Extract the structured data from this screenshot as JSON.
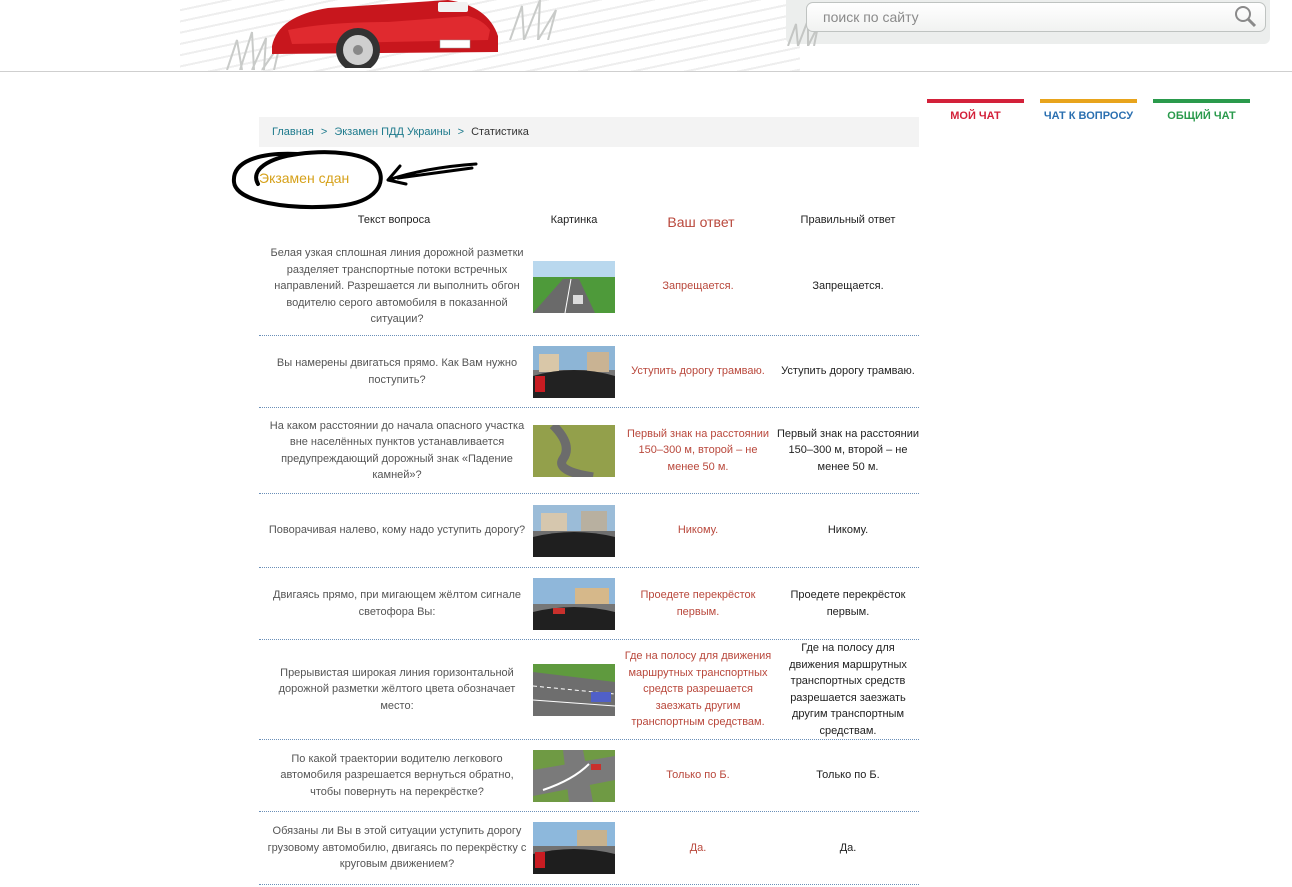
{
  "search": {
    "placeholder": "поиск по сайту"
  },
  "chat_tabs": {
    "my": "МОЙ ЧАТ",
    "question": "ЧАТ К ВОПРОСУ",
    "general": "ОБЩИЙ ЧАТ"
  },
  "breadcrumb": {
    "home": "Главная",
    "exam": "Экзамен ПДД Украины",
    "current": "Статистика",
    "separator": ">"
  },
  "exam_status": "Экзамен сдан",
  "table": {
    "headers": {
      "question": "Текст вопроса",
      "picture": "Картинка",
      "your_answer": "Ваш ответ",
      "correct_answer": "Правильный ответ"
    },
    "rows": [
      {
        "question": "Белая узкая сплошная линия дорожной разметки разделяет транспортные потоки встречных направлений. Разрешается ли выполнить обгон водителю серого автомобиля в показанной ситуации?",
        "answer": "Запрещается.",
        "correct": "Запрещается."
      },
      {
        "question": "Вы намерены двигаться прямо. Как Вам нужно поступить?",
        "answer": "Уступить дорогу трамваю.",
        "correct": "Уступить дорогу трамваю."
      },
      {
        "question": "На каком расстоянии до начала опасного участка вне населённых пунктов устанавливается предупреждающий дорожный знак «Падение камней»?",
        "answer": "Первый знак на расстоянии 150–300 м, второй – не менее 50 м.",
        "correct": "Первый знак на расстоянии 150–300 м, второй – не менее 50 м."
      },
      {
        "question": "Поворачивая налево, кому надо уступить дорогу?",
        "answer": "Никому.",
        "correct": "Никому."
      },
      {
        "question": "Двигаясь прямо, при мигающем жёлтом сигнале светофора Вы:",
        "answer": "Проедете перекрёсток первым.",
        "correct": "Проедете перекрёсток первым."
      },
      {
        "question": "Прерывистая широкая линия горизонтальной дорожной разметки жёлтого цвета обозначает место:",
        "answer": "Где на полосу для движения маршрутных транспортных средств разрешается заезжать другим транспортным средствам.",
        "correct": "Где на полосу для движения маршрутных транспортных средств разрешается заезжать другим транспортным средствам."
      },
      {
        "question": "По какой траектории водителю легкового автомобиля разрешается вернуться обратно, чтобы повернуть на перекрёстке?",
        "answer": "Только по Б.",
        "correct": "Только по Б."
      },
      {
        "question": "Обязаны ли Вы в этой ситуации уступить дорогу грузовому автомобилю, двигаясь по перекрёстку с круговым движением?",
        "answer": "Да.",
        "correct": "Да."
      }
    ]
  }
}
